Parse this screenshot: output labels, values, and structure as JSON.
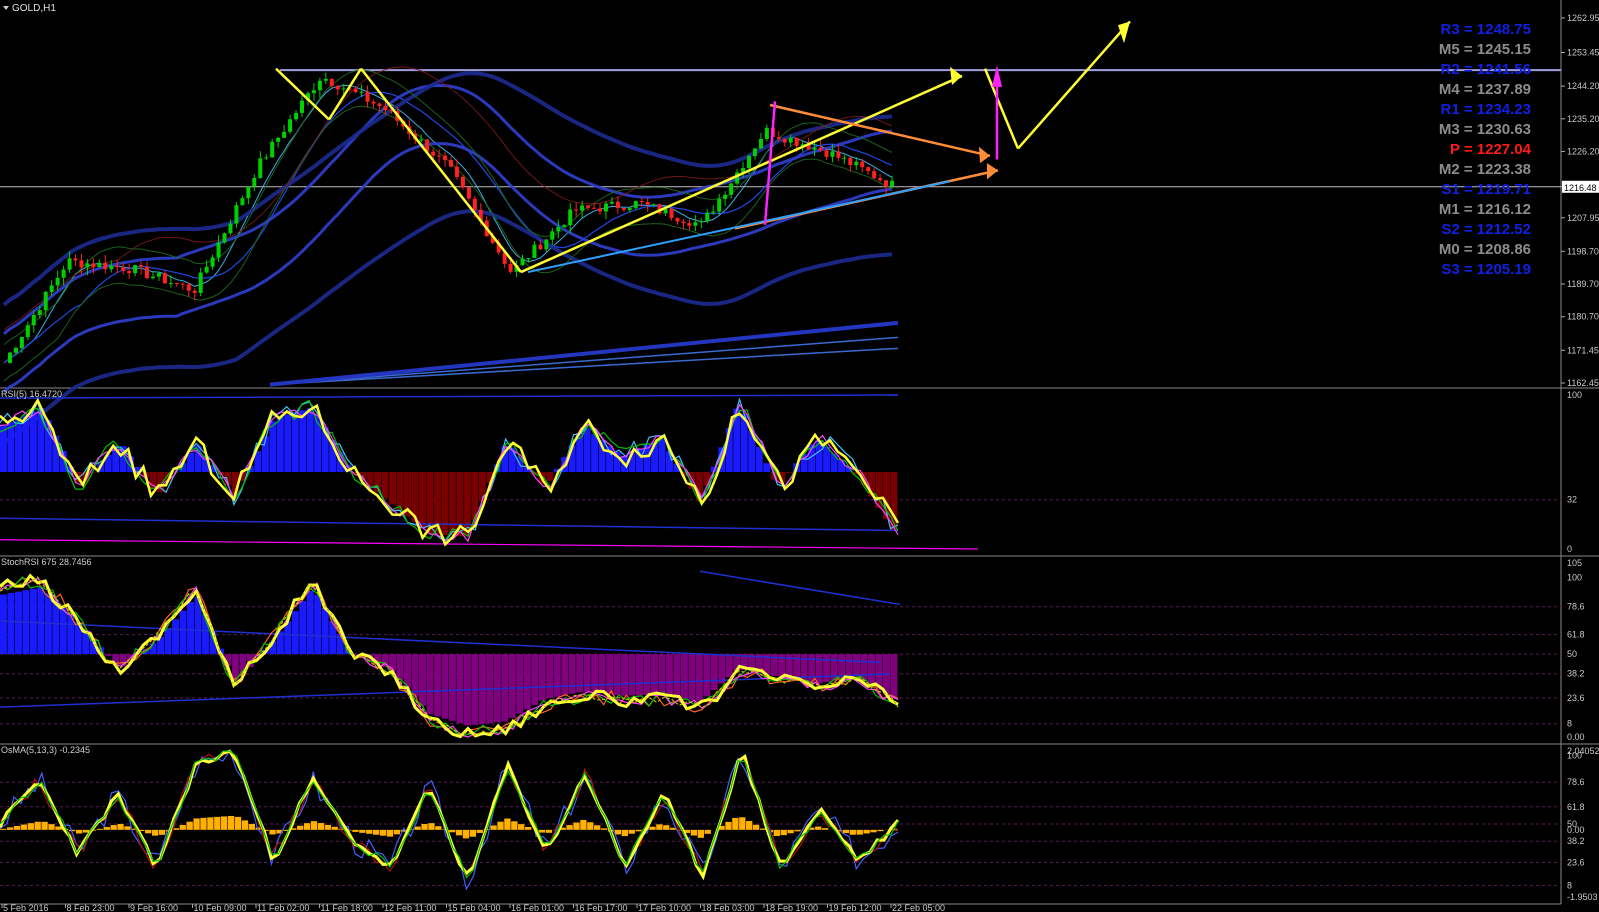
{
  "symbol_label": "GOLD,H1",
  "colors": {
    "background": "#000000",
    "bull_candle": "#00d000",
    "bear_candle": "#ff2020",
    "grid": "#2a2a2a",
    "axis_text": "#c8c8c8",
    "annotation_yellow": "#ffff33",
    "annotation_orange": "#ff8c3a",
    "annotation_magenta": "#ff22ff",
    "pivot_blue": "#1020e0",
    "pivot_gray": "#8c8c8c",
    "pivot_red": "#ff1a1a",
    "hist_blue": "#1a1aff",
    "hist_maroon": "#7a0000",
    "hist_purple": "#800080",
    "hist_gold": "#ffb000"
  },
  "pivot_levels": [
    {
      "text": "R3 = 1248.75",
      "kind": "resistance"
    },
    {
      "text": "M5 = 1245.15",
      "kind": "mid"
    },
    {
      "text": "R2 = 1241.56",
      "kind": "resistance"
    },
    {
      "text": "M4 = 1237.89",
      "kind": "mid"
    },
    {
      "text": "R1 = 1234.23",
      "kind": "resistance"
    },
    {
      "text": "M3 = 1230.63",
      "kind": "mid"
    },
    {
      "text": "P   = 1227.04",
      "kind": "pivot"
    },
    {
      "text": "M2 = 1223.38",
      "kind": "mid"
    },
    {
      "text": "S1 = 1219.71",
      "kind": "support"
    },
    {
      "text": "M1 = 1216.12",
      "kind": "mid"
    },
    {
      "text": "S2 = 1212.52",
      "kind": "support"
    },
    {
      "text": "M0 = 1208.86",
      "kind": "mid"
    },
    {
      "text": "S3 = 1205.19",
      "kind": "support"
    }
  ],
  "chart_data": [
    {
      "type": "line",
      "title": "GOLD,H1",
      "x": [
        "5 Feb 2016",
        "8 Feb 23:00",
        "9 Feb 16:00",
        "10 Feb 09:00",
        "11 Feb 02:00",
        "11 Feb 18:00",
        "12 Feb 11:00",
        "15 Feb 04:00",
        "16 Feb 01:00",
        "16 Feb 17:00",
        "17 Feb 10:00",
        "18 Feb 03:00",
        "18 Feb 19:00",
        "19 Feb 12:00",
        "22 Feb 05:00"
      ],
      "series": [
        {
          "values": [
            1168,
            1196,
            1194,
            1188,
            1222,
            1247,
            1238,
            1222,
            1193,
            1210,
            1212,
            1206,
            1232,
            1226,
            1217
          ]
        }
      ],
      "y_ticks": [
        "1262.95",
        "1253.45",
        "1244.20",
        "1235.20",
        "1226.20",
        "1216.48",
        "1207.95",
        "1198.70",
        "1189.70",
        "1180.70",
        "1171.45",
        "1162.45"
      ],
      "current_price": "1216.48",
      "ylim": [
        1162.45,
        1262.95
      ]
    },
    {
      "type": "line",
      "title": "RSI(5) 16.4720",
      "series": [
        {
          "values": [
            80,
            92,
            40,
            70,
            35,
            68,
            35,
            85,
            92,
            50,
            30,
            10,
            8,
            70,
            40,
            80,
            60,
            72,
            30,
            95,
            40,
            72,
            50,
            12
          ]
        }
      ],
      "y_ticks": [
        "100",
        "32",
        "0"
      ],
      "ylim": [
        0,
        100
      ]
    },
    {
      "type": "line",
      "title": "StochRSI 675 28.7456",
      "series": [
        {
          "values": [
            90,
            95,
            70,
            40,
            60,
            90,
            30,
            60,
            95,
            50,
            40,
            10,
            2,
            5,
            20,
            25,
            22,
            23,
            18,
            40,
            35,
            30,
            35,
            20
          ]
        }
      ],
      "y_ticks": [
        "105",
        "100",
        "78.6",
        "61.8",
        "50",
        "38.2",
        "23.6",
        "8",
        "0.00"
      ],
      "ylim": [
        0,
        105
      ]
    },
    {
      "type": "line",
      "title": "OsMA(5,13,3) -0.2345",
      "series": [
        {
          "values": [
            50,
            80,
            30,
            70,
            20,
            90,
            100,
            25,
            80,
            40,
            20,
            75,
            10,
            90,
            30,
            85,
            20,
            70,
            15,
            100,
            20,
            60,
            25,
            50
          ]
        }
      ],
      "y_ticks": [
        "2.04052",
        "100",
        "78.6",
        "61.8",
        "50",
        "0.00",
        "38.2",
        "23.6",
        "8",
        "-1.9503"
      ],
      "ylim": [
        -1.9503,
        2.04052
      ]
    }
  ]
}
